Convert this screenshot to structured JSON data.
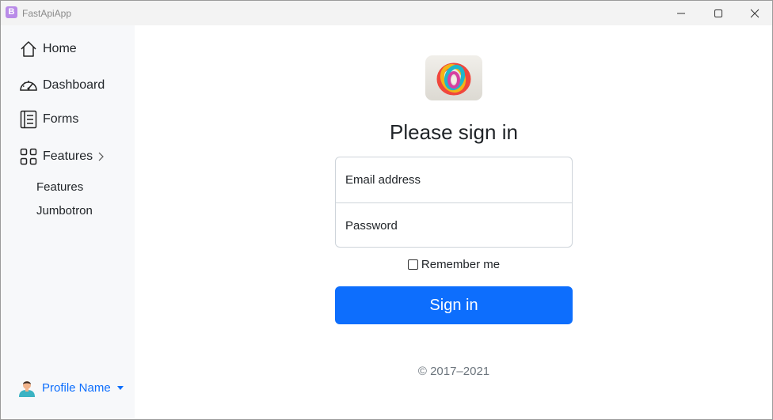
{
  "window": {
    "app_icon_letter": "B",
    "title": "FastApiApp",
    "controls": {
      "minimize": "minimize-icon",
      "maximize": "maximize-icon",
      "close": "close-icon"
    }
  },
  "sidebar": {
    "items": [
      {
        "label": "Home",
        "icon": "home-icon"
      },
      {
        "label": "Dashboard",
        "icon": "dashboard-icon"
      },
      {
        "label": "Forms",
        "icon": "forms-icon"
      },
      {
        "label": "Features",
        "icon": "grid-icon",
        "expanded": true
      }
    ],
    "subitems": [
      {
        "label": "Features"
      },
      {
        "label": "Jumbotron"
      }
    ],
    "profile": {
      "name": "Profile Name",
      "icon": "avatar-icon"
    }
  },
  "signin": {
    "heading": "Please sign in",
    "email_placeholder": "Email address",
    "password_placeholder": "Password",
    "remember_label": "Remember me",
    "remember_checked": false,
    "button_label": "Sign in",
    "copyright": "© 2017–2021"
  },
  "colors": {
    "primary": "#0d6efd",
    "sidebar_bg": "#f7f8fa",
    "text": "#212529",
    "muted": "#6c757d"
  }
}
